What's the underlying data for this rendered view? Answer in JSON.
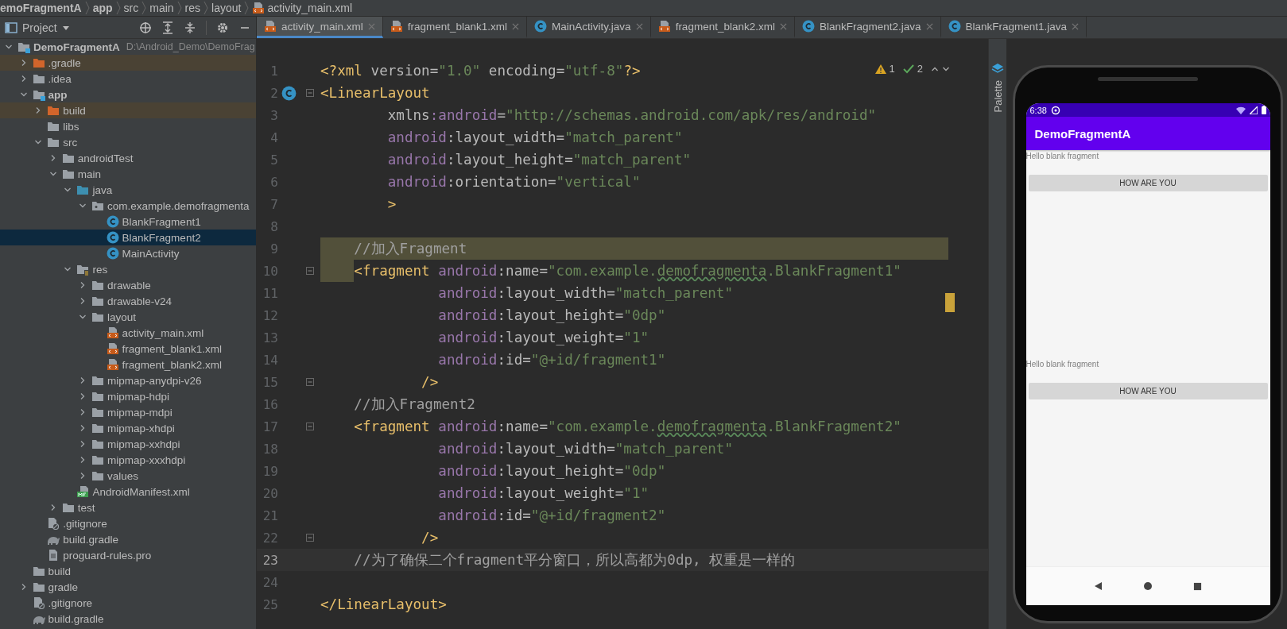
{
  "breadcrumb": [
    {
      "text": "emoFragmentA",
      "bold": true
    },
    {
      "text": "app",
      "bold": true
    },
    {
      "text": "src",
      "bold": false
    },
    {
      "text": "main",
      "bold": false
    },
    {
      "text": "res",
      "bold": false
    },
    {
      "text": "layout",
      "bold": false
    },
    {
      "text": "activity_main.xml",
      "bold": false,
      "kind": "xml"
    }
  ],
  "project_panel": {
    "title": "Project",
    "tree": [
      {
        "label": "DemoFragmentA",
        "path": "D:\\Android_Demo\\DemoFrag",
        "kind": "module",
        "expanded": true,
        "selected": false,
        "children": [
          {
            "label": ".gradle",
            "kind": "excluded_folder",
            "expanded": false,
            "selected": false
          },
          {
            "label": ".idea",
            "kind": "folder",
            "expanded": false,
            "selected": false
          },
          {
            "label": "app",
            "kind": "module",
            "expanded": true,
            "selected": false,
            "children": [
              {
                "label": "build",
                "kind": "excluded_folder",
                "expanded": false,
                "selected": false
              },
              {
                "label": "libs",
                "kind": "folder",
                "selected": false
              },
              {
                "label": "src",
                "kind": "folder",
                "expanded": true,
                "selected": false,
                "children": [
                  {
                    "label": "androidTest",
                    "kind": "folder",
                    "expanded": false,
                    "selected": false
                  },
                  {
                    "label": "main",
                    "kind": "folder",
                    "expanded": true,
                    "selected": false,
                    "children": [
                      {
                        "label": "java",
                        "kind": "java_folder",
                        "expanded": true,
                        "selected": false,
                        "children": [
                          {
                            "label": "com.example.demofragmenta",
                            "kind": "package",
                            "expanded": true,
                            "selected": false,
                            "children": [
                              {
                                "label": "BlankFragment1",
                                "kind": "class",
                                "selected": false
                              },
                              {
                                "label": "BlankFragment2",
                                "kind": "class",
                                "selected": true
                              },
                              {
                                "label": "MainActivity",
                                "kind": "class",
                                "selected": false
                              }
                            ]
                          }
                        ]
                      },
                      {
                        "label": "res",
                        "kind": "res_folder",
                        "expanded": true,
                        "selected": false,
                        "children": [
                          {
                            "label": "drawable",
                            "kind": "folder",
                            "expanded": false,
                            "selected": false
                          },
                          {
                            "label": "drawable-v24",
                            "kind": "folder",
                            "expanded": false,
                            "selected": false
                          },
                          {
                            "label": "layout",
                            "kind": "folder",
                            "expanded": true,
                            "selected": false,
                            "children": [
                              {
                                "label": "activity_main.xml",
                                "kind": "xml",
                                "selected": false
                              },
                              {
                                "label": "fragment_blank1.xml",
                                "kind": "xml",
                                "selected": false
                              },
                              {
                                "label": "fragment_blank2.xml",
                                "kind": "xml",
                                "selected": false
                              }
                            ]
                          },
                          {
                            "label": "mipmap-anydpi-v26",
                            "kind": "folder",
                            "expanded": false,
                            "selected": false
                          },
                          {
                            "label": "mipmap-hdpi",
                            "kind": "folder",
                            "expanded": false,
                            "selected": false
                          },
                          {
                            "label": "mipmap-mdpi",
                            "kind": "folder",
                            "expanded": false,
                            "selected": false
                          },
                          {
                            "label": "mipmap-xhdpi",
                            "kind": "folder",
                            "expanded": false,
                            "selected": false
                          },
                          {
                            "label": "mipmap-xxhdpi",
                            "kind": "folder",
                            "expanded": false,
                            "selected": false
                          },
                          {
                            "label": "mipmap-xxxhdpi",
                            "kind": "folder",
                            "expanded": false,
                            "selected": false
                          },
                          {
                            "label": "values",
                            "kind": "folder",
                            "expanded": false,
                            "selected": false
                          }
                        ]
                      },
                      {
                        "label": "AndroidManifest.xml",
                        "kind": "manifest",
                        "selected": false
                      }
                    ]
                  },
                  {
                    "label": "test",
                    "kind": "folder",
                    "expanded": false,
                    "selected": false
                  }
                ]
              },
              {
                "label": ".gitignore",
                "kind": "ignore",
                "selected": false
              },
              {
                "label": "build.gradle",
                "kind": "gradle",
                "selected": false
              },
              {
                "label": "proguard-rules.pro",
                "kind": "text",
                "selected": false
              }
            ]
          },
          {
            "label": "build",
            "kind": "folder",
            "selected": false
          },
          {
            "label": "gradle",
            "kind": "folder",
            "expanded": false,
            "selected": false
          },
          {
            "label": ".gitignore",
            "kind": "ignore",
            "selected": false
          },
          {
            "label": "build.gradle",
            "kind": "gradle",
            "selected": false
          }
        ]
      }
    ]
  },
  "tabs": [
    {
      "label": "activity_main.xml",
      "kind": "xml",
      "selected": true
    },
    {
      "label": "fragment_blank1.xml",
      "kind": "xml",
      "selected": false
    },
    {
      "label": "MainActivity.java",
      "kind": "class",
      "selected": false
    },
    {
      "label": "fragment_blank2.xml",
      "kind": "xml",
      "selected": false
    },
    {
      "label": "BlankFragment2.java",
      "kind": "class",
      "selected": false
    },
    {
      "label": "BlankFragment1.java",
      "kind": "class",
      "selected": false
    }
  ],
  "editor": {
    "warnings": "1",
    "weak_warnings": "2",
    "lines": [
      {
        "number": "1",
        "tokens": [
          {
            "kind": "tag",
            "text": "<?xml"
          },
          {
            "kind": "plain",
            "text": " version"
          },
          {
            "kind": "punct",
            "text": "="
          },
          {
            "kind": "value",
            "text": "\"1.0\""
          },
          {
            "kind": "plain",
            "text": " encoding"
          },
          {
            "kind": "punct",
            "text": "="
          },
          {
            "kind": "value",
            "text": "\"utf-8\""
          },
          {
            "kind": "tag",
            "text": "?>"
          }
        ]
      },
      {
        "number": "2",
        "class_icon": true,
        "fold": true,
        "tokens": [
          {
            "kind": "tag",
            "text": "<LinearLayout"
          }
        ]
      },
      {
        "number": "3",
        "tokens": [
          {
            "kind": "plain",
            "text": "        xmlns"
          },
          {
            "kind": "ns",
            "text": ":android"
          },
          {
            "kind": "punct",
            "text": "="
          },
          {
            "kind": "value",
            "text": "\"http://schemas.android.com/apk/res/android\""
          }
        ]
      },
      {
        "number": "4",
        "tokens": [
          {
            "kind": "ns",
            "text": "        android"
          },
          {
            "kind": "plain",
            "text": ":layout_width"
          },
          {
            "kind": "punct",
            "text": "="
          },
          {
            "kind": "value",
            "text": "\"match_parent\""
          }
        ]
      },
      {
        "number": "5",
        "tokens": [
          {
            "kind": "ns",
            "text": "        android"
          },
          {
            "kind": "plain",
            "text": ":layout_height"
          },
          {
            "kind": "punct",
            "text": "="
          },
          {
            "kind": "value",
            "text": "\"match_parent\""
          }
        ]
      },
      {
        "number": "6",
        "tokens": [
          {
            "kind": "ns",
            "text": "        android"
          },
          {
            "kind": "plain",
            "text": ":orientation"
          },
          {
            "kind": "punct",
            "text": "="
          },
          {
            "kind": "value",
            "text": "\"vertical\""
          }
        ]
      },
      {
        "number": "7",
        "tokens": [
          {
            "kind": "tag",
            "text": "        >"
          }
        ]
      },
      {
        "number": "8"
      },
      {
        "number": "9",
        "highlighted": true,
        "tokens": [
          {
            "kind": "comment",
            "text": "    //加入Fragment"
          }
        ]
      },
      {
        "number": "10",
        "fold": true,
        "indent_highlighted": true,
        "tokens": [
          {
            "kind": "tag",
            "text": "<fragment "
          },
          {
            "kind": "ns",
            "text": "android"
          },
          {
            "kind": "plain",
            "text": ":name"
          },
          {
            "kind": "punct",
            "text": "="
          },
          {
            "kind": "value",
            "text": "\"com.example."
          },
          {
            "kind": "typo",
            "text": "demofragmenta"
          },
          {
            "kind": "value",
            "text": ".BlankFragment1\""
          }
        ]
      },
      {
        "number": "11",
        "tokens": [
          {
            "kind": "ns",
            "text": "              android"
          },
          {
            "kind": "plain",
            "text": ":layout_width"
          },
          {
            "kind": "punct",
            "text": "="
          },
          {
            "kind": "value",
            "text": "\"match_parent\""
          }
        ]
      },
      {
        "number": "12",
        "tokens": [
          {
            "kind": "ns",
            "text": "              android"
          },
          {
            "kind": "plain",
            "text": ":layout_height"
          },
          {
            "kind": "punct",
            "text": "="
          },
          {
            "kind": "value",
            "text": "\"0dp\""
          }
        ]
      },
      {
        "number": "13",
        "tokens": [
          {
            "kind": "ns",
            "text": "              android"
          },
          {
            "kind": "plain",
            "text": ":layout_weight"
          },
          {
            "kind": "punct",
            "text": "="
          },
          {
            "kind": "value",
            "text": "\"1\""
          }
        ]
      },
      {
        "number": "14",
        "tokens": [
          {
            "kind": "ns",
            "text": "              android"
          },
          {
            "kind": "plain",
            "text": ":id"
          },
          {
            "kind": "punct",
            "text": "="
          },
          {
            "kind": "value",
            "text": "\"@+id/fragment1\""
          }
        ]
      },
      {
        "number": "15",
        "fold": true,
        "tokens": [
          {
            "kind": "tag",
            "text": "            />"
          }
        ]
      },
      {
        "number": "16",
        "tokens": [
          {
            "kind": "comment",
            "text": "    //加入Fragment2"
          }
        ]
      },
      {
        "number": "17",
        "fold": true,
        "tokens": [
          {
            "kind": "tag",
            "text": "    <fragment "
          },
          {
            "kind": "ns",
            "text": "android"
          },
          {
            "kind": "plain",
            "text": ":name"
          },
          {
            "kind": "punct",
            "text": "="
          },
          {
            "kind": "value",
            "text": "\"com.example."
          },
          {
            "kind": "typo",
            "text": "demofragmenta"
          },
          {
            "kind": "value",
            "text": ".BlankFragment2\""
          }
        ]
      },
      {
        "number": "18",
        "tokens": [
          {
            "kind": "ns",
            "text": "              android"
          },
          {
            "kind": "plain",
            "text": ":layout_width"
          },
          {
            "kind": "punct",
            "text": "="
          },
          {
            "kind": "value",
            "text": "\"match_parent\""
          }
        ]
      },
      {
        "number": "19",
        "tokens": [
          {
            "kind": "ns",
            "text": "              android"
          },
          {
            "kind": "plain",
            "text": ":layout_height"
          },
          {
            "kind": "punct",
            "text": "="
          },
          {
            "kind": "value",
            "text": "\"0dp\""
          }
        ]
      },
      {
        "number": "20",
        "tokens": [
          {
            "kind": "ns",
            "text": "              android"
          },
          {
            "kind": "plain",
            "text": ":layout_weight"
          },
          {
            "kind": "punct",
            "text": "="
          },
          {
            "kind": "value",
            "text": "\"1\""
          }
        ]
      },
      {
        "number": "21",
        "tokens": [
          {
            "kind": "ns",
            "text": "              android"
          },
          {
            "kind": "plain",
            "text": ":id"
          },
          {
            "kind": "punct",
            "text": "="
          },
          {
            "kind": "value",
            "text": "\"@+id/fragment2\""
          }
        ]
      },
      {
        "number": "22",
        "fold": true,
        "tokens": [
          {
            "kind": "tag",
            "text": "            />"
          }
        ]
      },
      {
        "number": "23",
        "current": true,
        "tokens": [
          {
            "kind": "comment",
            "text": "    //为了确保二个fragment平分窗口，所以高都为0dp, 权重是一样的"
          }
        ]
      },
      {
        "number": "24"
      },
      {
        "number": "25",
        "tokens": [
          {
            "kind": "tag",
            "text": "</LinearLayout>"
          }
        ]
      }
    ]
  },
  "side_strip": {
    "label": "Palette"
  },
  "emulator": {
    "time": "6:38",
    "app_title": "DemoFragmentA",
    "fragments": [
      {
        "text": "Hello blank fragment",
        "button": "HOW ARE YOU"
      },
      {
        "text": "Hello blank fragment",
        "button": "HOW ARE YOU"
      }
    ]
  }
}
